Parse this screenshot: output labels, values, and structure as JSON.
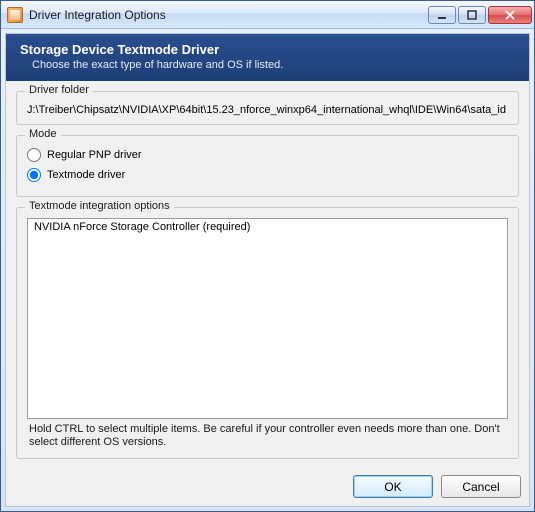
{
  "window": {
    "title": "Driver Integration Options"
  },
  "header": {
    "title": "Storage Device Textmode Driver",
    "subtitle": "Choose the exact type of hardware and OS if listed."
  },
  "driverFolder": {
    "legend": "Driver folder",
    "path": "J:\\Treiber\\Chipsatz\\NVIDIA\\XP\\64bit\\15.23_nforce_winxp64_international_whql\\IDE\\Win64\\sata_id"
  },
  "mode": {
    "legend": "Mode",
    "options": {
      "pnp": "Regular PNP driver",
      "textmode": "Textmode driver"
    },
    "selected": "textmode"
  },
  "textmodeOptions": {
    "legend": "Textmode integration options",
    "items": [
      "NVIDIA nForce Storage Controller (required)"
    ],
    "hint": "Hold CTRL to select multiple items. Be careful if your controller even needs more than one. Don't select different OS versions."
  },
  "buttons": {
    "ok": "OK",
    "cancel": "Cancel"
  }
}
